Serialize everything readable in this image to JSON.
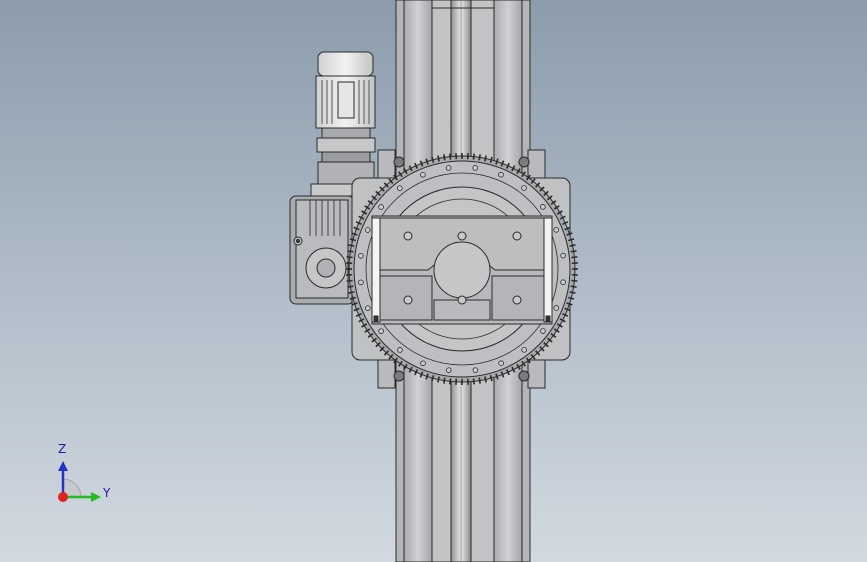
{
  "triad": {
    "z_label": "Z",
    "y_label": "Y"
  },
  "colors": {
    "background_top": "#8c9cac",
    "background_bottom": "#d2d9e0",
    "part_fill": "#b7b9bc",
    "part_dark": "#8e9093",
    "edge": "#2a2a2a",
    "axis_z": "#2233cc",
    "axis_y": "#22bb22",
    "axis_x": "#dd2222"
  },
  "icons": [
    "coordinate-triad-icon"
  ]
}
